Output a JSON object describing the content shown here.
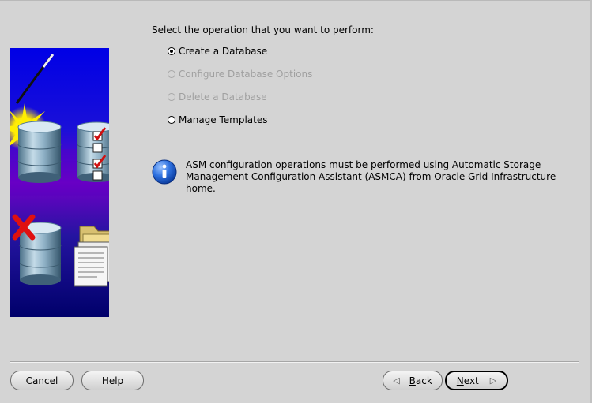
{
  "operation": {
    "prompt": "Select the operation that you want to perform:",
    "options": [
      {
        "label": "Create a Database",
        "selected": true,
        "enabled": true
      },
      {
        "label": "Configure Database Options",
        "selected": false,
        "enabled": false
      },
      {
        "label": "Delete a Database",
        "selected": false,
        "enabled": false
      },
      {
        "label": "Manage Templates",
        "selected": false,
        "enabled": true
      }
    ]
  },
  "info": {
    "icon": "info-icon",
    "line1": "ASM configuration operations must be performed using Automatic Storage",
    "line2": "Management Configuration Assistant (ASMCA) from Oracle Grid Infrastructure home."
  },
  "buttons": {
    "cancel": "Cancel",
    "help": "Help",
    "back_mnemonic": "B",
    "back_rest": "ack",
    "next_mnemonic": "N",
    "next_rest": "ext"
  },
  "colors": {
    "panel_bg": "#d4d4d4",
    "banner_top": "#0000e0",
    "banner_mid": "#6a00c8",
    "banner_bottom": "#00006e",
    "disabled_text": "#a0a0a0",
    "info_blue": "#1e5fd6",
    "checkmark_red": "#d01010"
  }
}
